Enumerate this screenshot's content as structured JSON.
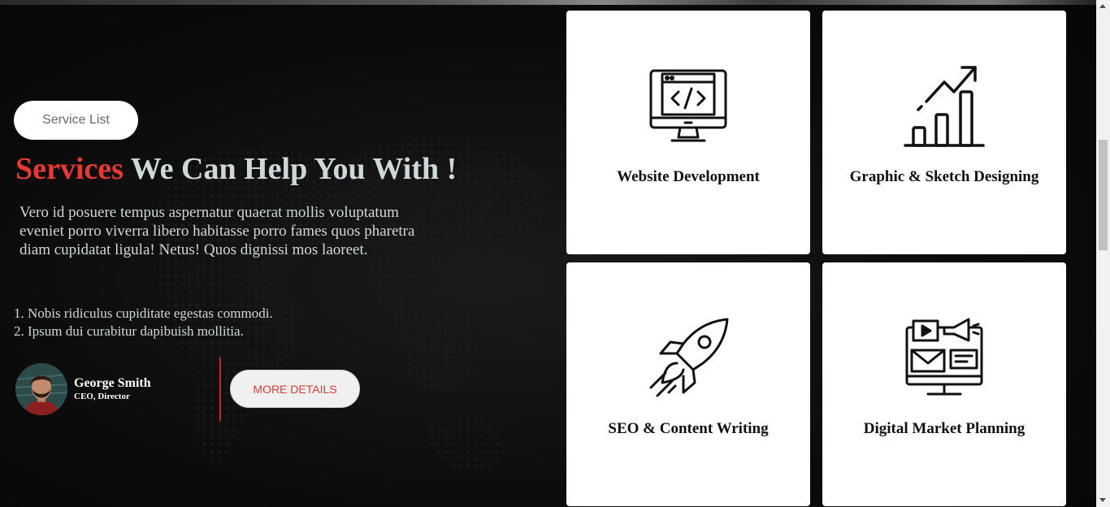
{
  "section": {
    "badge": "Service List",
    "headline_accent": "Services",
    "headline_rest": " We Can Help You With !",
    "lead": "Vero id posuere tempus aspernatur quaerat mollis voluptatum eveniet porro viverra libero habitasse porro fames quos pharetra diam cupidatat ligula! Netus! Quos dignissi mos laoreet.",
    "points": [
      "1. Nobis ridiculus cupiditate egestas commodi.",
      "2. Ipsum dui curabitur dapibuish mollitia."
    ],
    "author": {
      "name": "George Smith",
      "role": "CEO, Director"
    },
    "cta": "MORE DETAILS"
  },
  "cards": [
    {
      "title": "Website Development",
      "icon": "monitor-code-icon"
    },
    {
      "title": "Graphic & Sketch Designing",
      "icon": "growth-chart-icon"
    },
    {
      "title": "SEO & Content Writing",
      "icon": "rocket-icon"
    },
    {
      "title": "Digital Market Planning",
      "icon": "digital-marketing-icon"
    }
  ],
  "colors": {
    "accent": "#e53935",
    "background": "#0b0b0b",
    "card": "#ffffff",
    "text_light": "#cfd8d8"
  }
}
